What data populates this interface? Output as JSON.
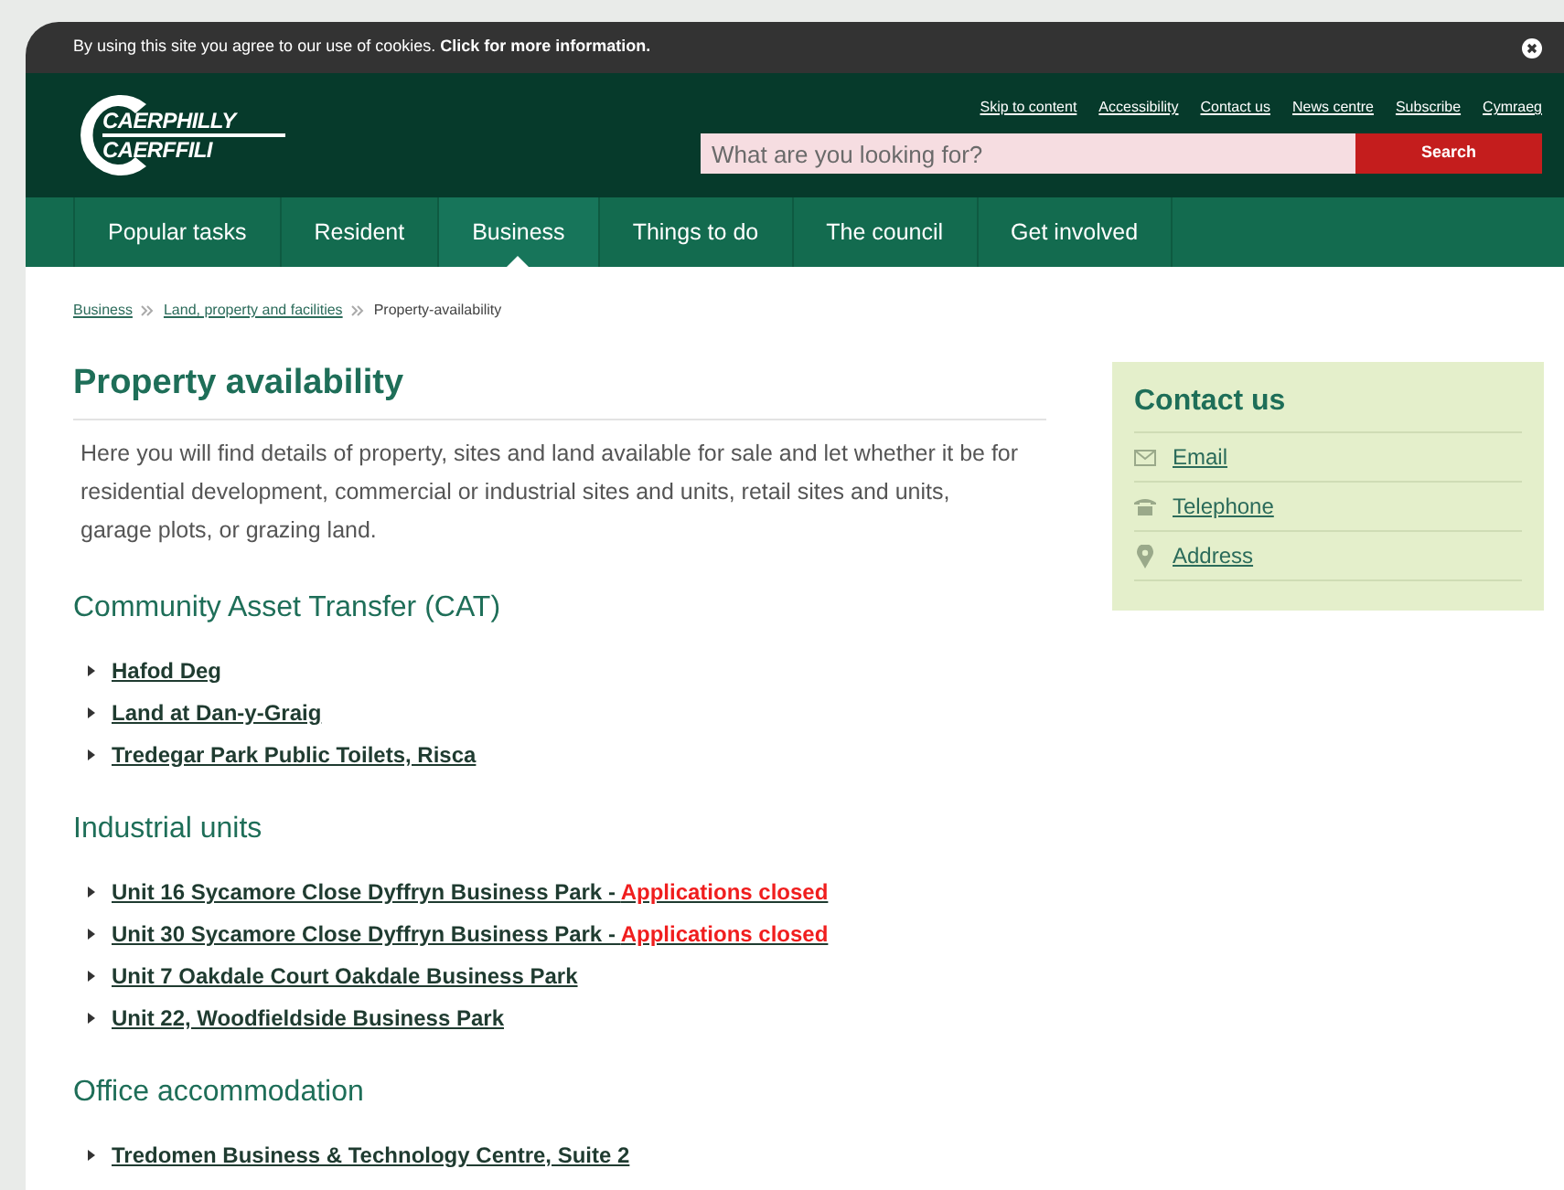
{
  "cookie_bar": {
    "text": "By using this site you agree to our use of cookies.",
    "link": "Click for more information."
  },
  "logo": {
    "line_1": "CAERPHILLY",
    "line_2": "CAERFFILI"
  },
  "utility_links": [
    "Skip to content",
    "Accessibility",
    "Contact us",
    "News centre",
    "Subscribe",
    "Cymraeg"
  ],
  "search": {
    "placeholder": "What are you looking for?",
    "button": "Search"
  },
  "nav": [
    {
      "label": "Popular tasks",
      "selected": false
    },
    {
      "label": "Resident",
      "selected": false
    },
    {
      "label": "Business",
      "selected": true
    },
    {
      "label": "Things to do",
      "selected": false
    },
    {
      "label": "The council",
      "selected": false
    },
    {
      "label": "Get involved",
      "selected": false
    }
  ],
  "breadcrumb": {
    "links": [
      "Business",
      "Land, property and facilities"
    ],
    "current": "Property-availability"
  },
  "page_title": "Property availability",
  "intro": "Here you will find details of property, sites and land available for sale and let whether it be for residential development, commercial or industrial sites and units, retail sites and units, garage plots, or grazing land.",
  "sections": [
    {
      "heading": "Community Asset Transfer (CAT)",
      "items": [
        {
          "label": "Hafod Deg"
        },
        {
          "label": "Land at Dan-y-Graig"
        },
        {
          "label": "Tredegar Park Public Toilets, Risca"
        }
      ]
    },
    {
      "heading": "Industrial units",
      "items": [
        {
          "label": "Unit 16 Sycamore Close Dyffryn Business Park - ",
          "note": "Applications closed"
        },
        {
          "label": "Unit 30 Sycamore Close Dyffryn Business Park - ",
          "note": "Applications closed"
        },
        {
          "label": "Unit 7 Oakdale Court Oakdale Business Park"
        },
        {
          "label": "Unit 22, Woodfieldside Business Park"
        }
      ]
    },
    {
      "heading": "Office accommodation",
      "items": [
        {
          "label": "Tredomen Business & Technology Centre, Suite 2"
        }
      ]
    }
  ],
  "contact": {
    "title": "Contact us",
    "items": [
      {
        "kind": "email",
        "label": "Email"
      },
      {
        "kind": "phone",
        "label": "Telephone"
      },
      {
        "kind": "address",
        "label": "Address"
      }
    ]
  }
}
